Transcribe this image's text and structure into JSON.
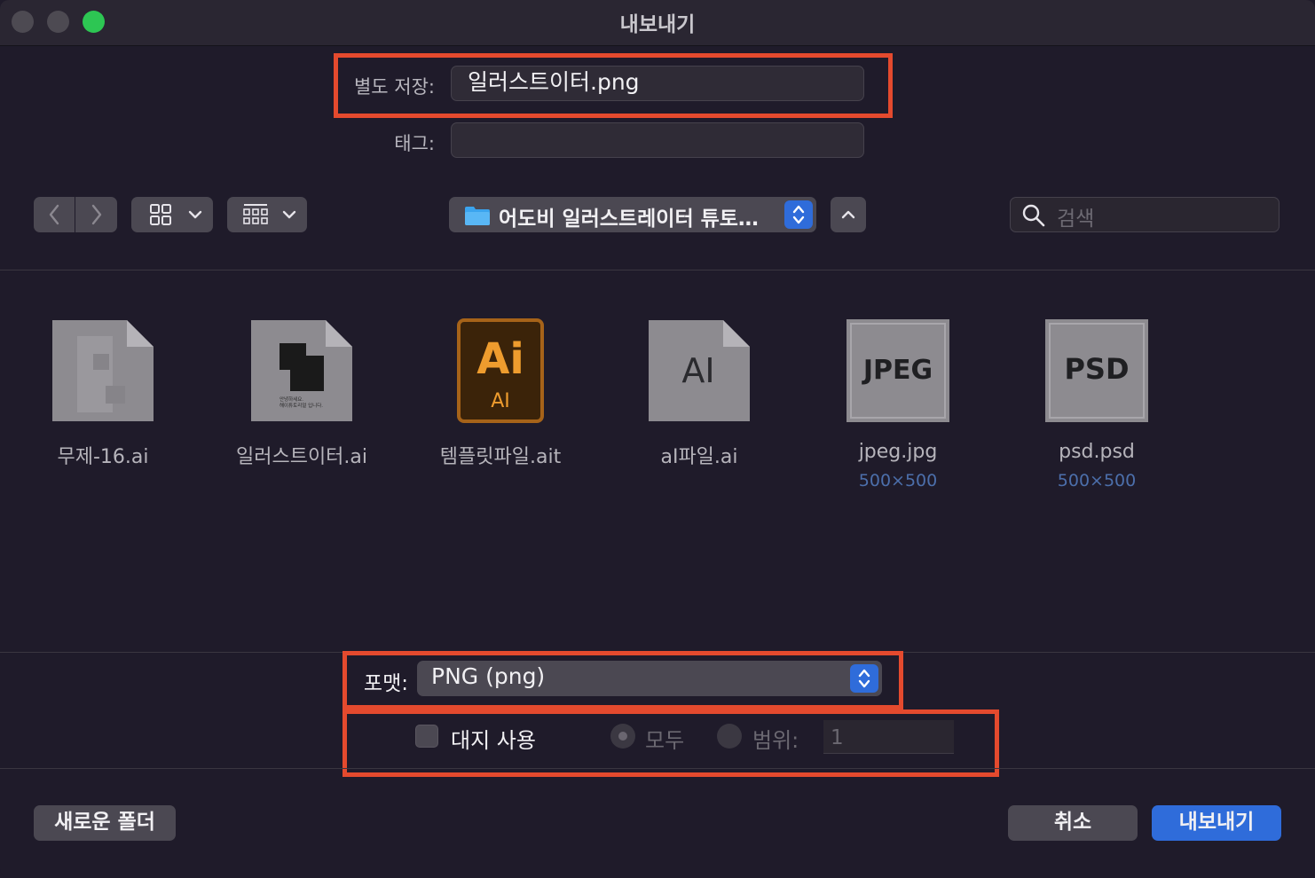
{
  "window": {
    "title": "내보내기"
  },
  "save_as": {
    "label": "별도 저장:",
    "value": "일러스트이터.png"
  },
  "tags": {
    "label": "태그:",
    "value": ""
  },
  "toolbar": {
    "location": "어도비 일러스트레이터 튜토…",
    "search_placeholder": "검색"
  },
  "files": [
    {
      "name": "무제-16.ai",
      "icon": "ai-document-icon"
    },
    {
      "name": "일러스트이터.ai",
      "icon": "ai-document-preview-icon",
      "preview_line1": "안녕하세요.",
      "preview_line2": "해이튜토리얼 입니다."
    },
    {
      "name": "템플릿파일.ait",
      "icon": "illustrator-template-icon",
      "badge_top": "Ai",
      "badge_bottom": "AI"
    },
    {
      "name": "aI파일.ai",
      "icon": "ai-generic-icon",
      "badge": "AI"
    },
    {
      "name": "jpeg.jpg",
      "icon": "jpeg-icon",
      "badge": "JPEG",
      "dims": "500×500"
    },
    {
      "name": "psd.psd",
      "icon": "psd-icon",
      "badge": "PSD",
      "dims": "500×500"
    }
  ],
  "format": {
    "label": "포맷:",
    "value": "PNG (png)"
  },
  "artboard": {
    "checkbox_label": "대지 사용",
    "all_label": "모두",
    "range_label": "범위:",
    "range_value": "1"
  },
  "buttons": {
    "new_folder": "새로운 폴더",
    "cancel": "취소",
    "export": "내보내기"
  },
  "colors": {
    "accent": "#2f6cda",
    "highlight": "#e44a2e",
    "background": "#1f1b2a"
  }
}
